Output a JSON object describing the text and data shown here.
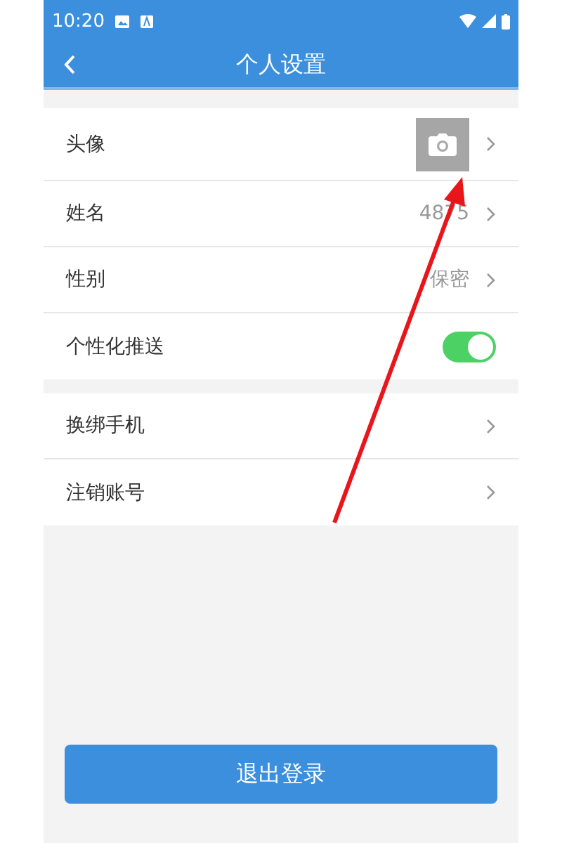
{
  "status_bar": {
    "time": "10:20"
  },
  "nav": {
    "title": "个人设置"
  },
  "groups": [
    {
      "rows": [
        {
          "kind": "avatar",
          "label": "头像"
        },
        {
          "kind": "value",
          "label": "姓名",
          "value": "4875"
        },
        {
          "kind": "value",
          "label": "性别",
          "value": "保密"
        },
        {
          "kind": "switch",
          "label": "个性化推送",
          "on": true
        }
      ]
    },
    {
      "rows": [
        {
          "kind": "link",
          "label": "换绑手机"
        },
        {
          "kind": "link",
          "label": "注销账号"
        }
      ]
    }
  ],
  "logout_button": "退出登录"
}
